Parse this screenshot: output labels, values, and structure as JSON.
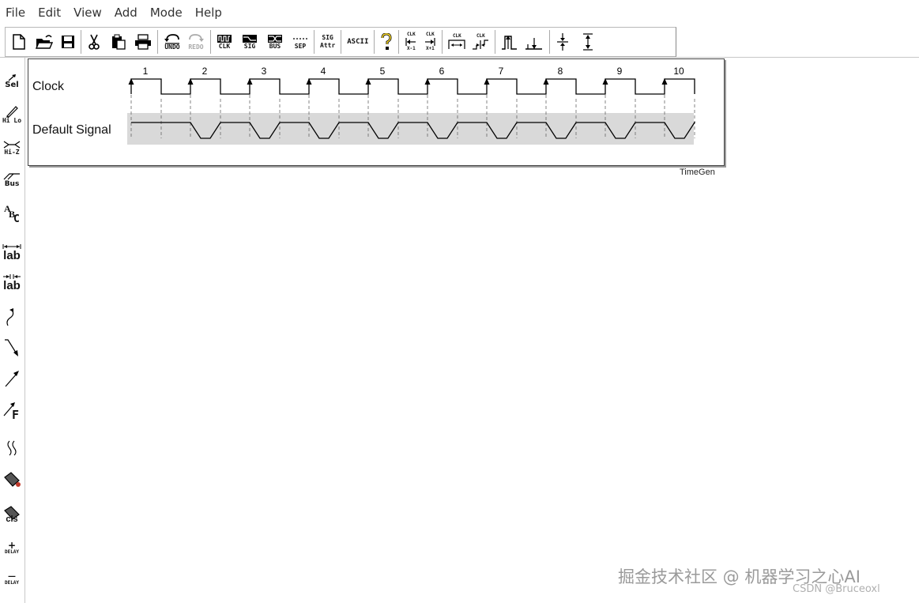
{
  "menu": [
    "File",
    "Edit",
    "View",
    "Add",
    "Mode",
    "Help"
  ],
  "toolbar": {
    "undo": "UNDO",
    "redo": "REDO",
    "clk": "CLK",
    "sig": "SIG",
    "bus": "BUS",
    "sep": "SEP",
    "sig_attr_top": "SIG",
    "sig_attr_bottom": "Attr",
    "ascii": "ASCII",
    "clk_tag": "CLK",
    "x_minus": "X-1",
    "x_plus": "X+1"
  },
  "palette": {
    "sel": "Sel",
    "hilo": "Hi Lo",
    "hiz": "Hi-Z",
    "bus": "Bus",
    "abc_a": "A",
    "abc_b": "B",
    "abc_c": "C",
    "lab1": "lab",
    "lab2": "lab",
    "flag_f": "F",
    "cls": "cls",
    "plus_delay_sign": "+",
    "plus_delay": "DELAY",
    "minus_delay_sign": "—",
    "minus_delay": "DELAY"
  },
  "signals": [
    {
      "name": "Clock",
      "type": "clock"
    },
    {
      "name": "Default Signal",
      "type": "signal"
    }
  ],
  "clock_numbers": [
    "1",
    "2",
    "3",
    "4",
    "5",
    "6",
    "7",
    "8",
    "9",
    "10"
  ],
  "brand": "TimeGen",
  "watermark": "掘金技术社区 @ 机器学习之心AI",
  "watermark2": "CSDN @Bruceoxl",
  "colors": {
    "signal_band": "#d9d9d9",
    "wave": "#000000",
    "dashed": "#666666"
  }
}
